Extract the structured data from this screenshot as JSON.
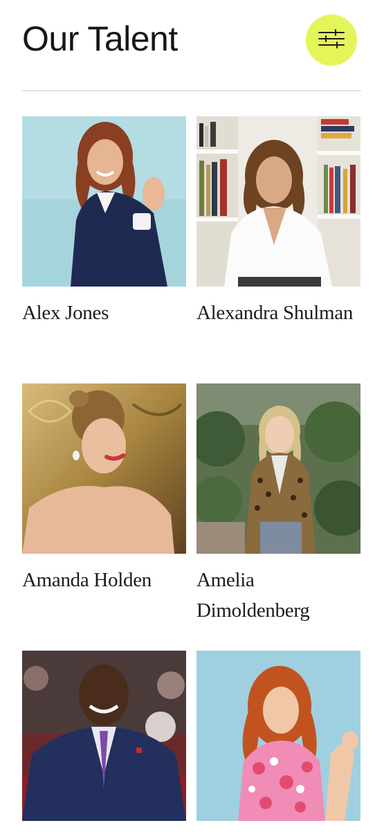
{
  "header": {
    "title": "Our Talent",
    "filter_icon": "sliders-icon",
    "filter_button_color": "#e4f55a"
  },
  "talent": [
    {
      "name": "Alex Jones",
      "photo_bg": "#a9d6dd"
    },
    {
      "name": "Alexandra Shulman",
      "photo_bg": "#efece6"
    },
    {
      "name": "Amanda Holden",
      "photo_bg": "#c9a66a"
    },
    {
      "name": "Amelia Dimoldenberg",
      "photo_bg": "#5f7550"
    },
    {
      "name": "",
      "photo_bg": "#7b2b2e"
    },
    {
      "name": "",
      "photo_bg": "#9fd0df"
    }
  ]
}
